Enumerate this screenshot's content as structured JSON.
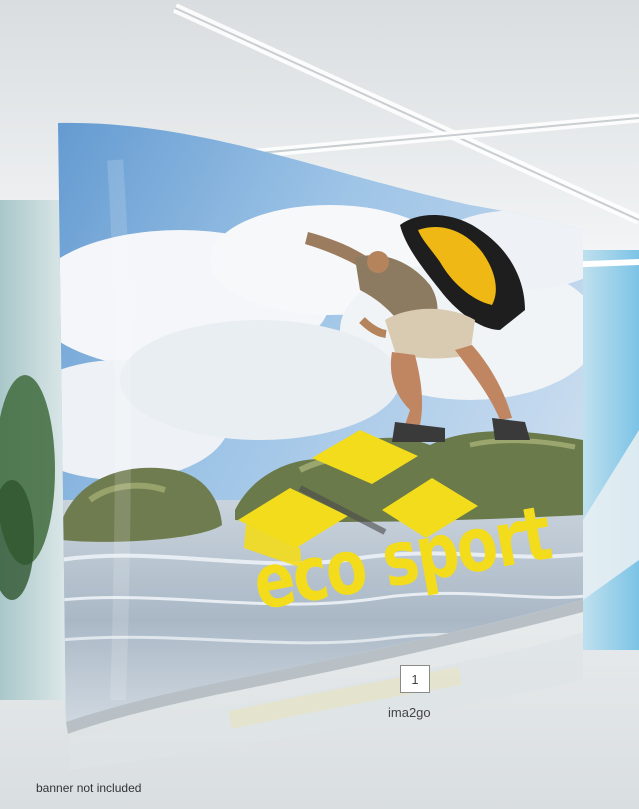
{
  "photo": {
    "alt": "Curved exhibition pop-up display showing a hiker with a yellow backpack leaping between rocks above water, with a yellow eco sport logo"
  },
  "banner": {
    "brand": "eco sport"
  },
  "item_number": "1",
  "item_name": "ima2go",
  "footnote": "banner not included",
  "colors": {
    "accent_yellow": "#f3dc1b",
    "sky_blue": "#6ea4d6",
    "floor": "#e7ebec"
  }
}
